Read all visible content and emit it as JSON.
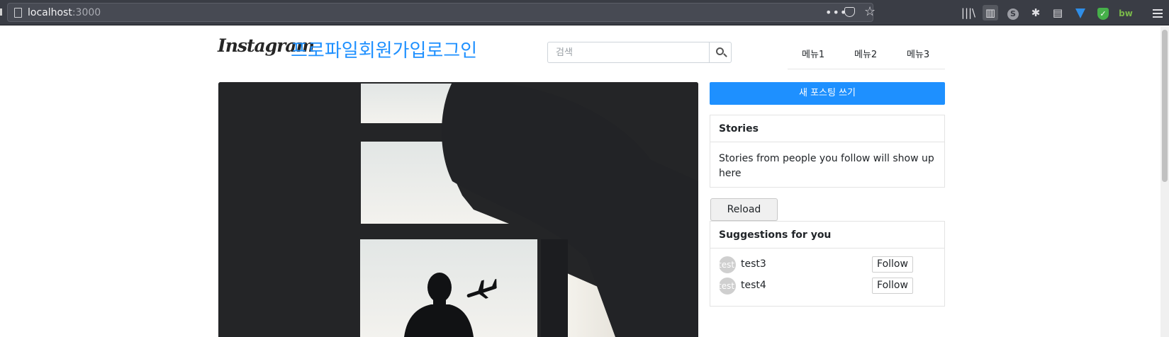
{
  "browser": {
    "url_host": "localhost",
    "url_port": ":3000",
    "toolbar_icons": [
      "library-icon",
      "sidebar-icon",
      "sync-account-icon",
      "extension-paw-icon",
      "reader-icon",
      "gem-extension-icon",
      "shield-check-icon",
      "bw-extension-icon",
      "hamburger-menu-icon"
    ],
    "sync_letter": "S",
    "bw_label": "bw"
  },
  "header": {
    "logo": "Instagram",
    "links": [
      "프로파일",
      "회원가입",
      "로그인"
    ],
    "search_placeholder": "검색",
    "menu": [
      "메뉴1",
      "메뉴2",
      "메뉴3"
    ]
  },
  "sidebar": {
    "new_post_label": "새 포스팅 쓰기",
    "stories": {
      "title": "Stories",
      "body": "Stories from people you follow will show up here"
    },
    "reload_label": "Reload",
    "suggestions": {
      "title": "Suggestions for you",
      "users": [
        {
          "avatar_text": "test",
          "username": "test3",
          "follow_label": "Follow"
        },
        {
          "avatar_text": "test",
          "username": "test4",
          "follow_label": "Follow"
        }
      ]
    }
  },
  "colors": {
    "accent": "#1e90ff",
    "chrome": "#3a3d45"
  }
}
